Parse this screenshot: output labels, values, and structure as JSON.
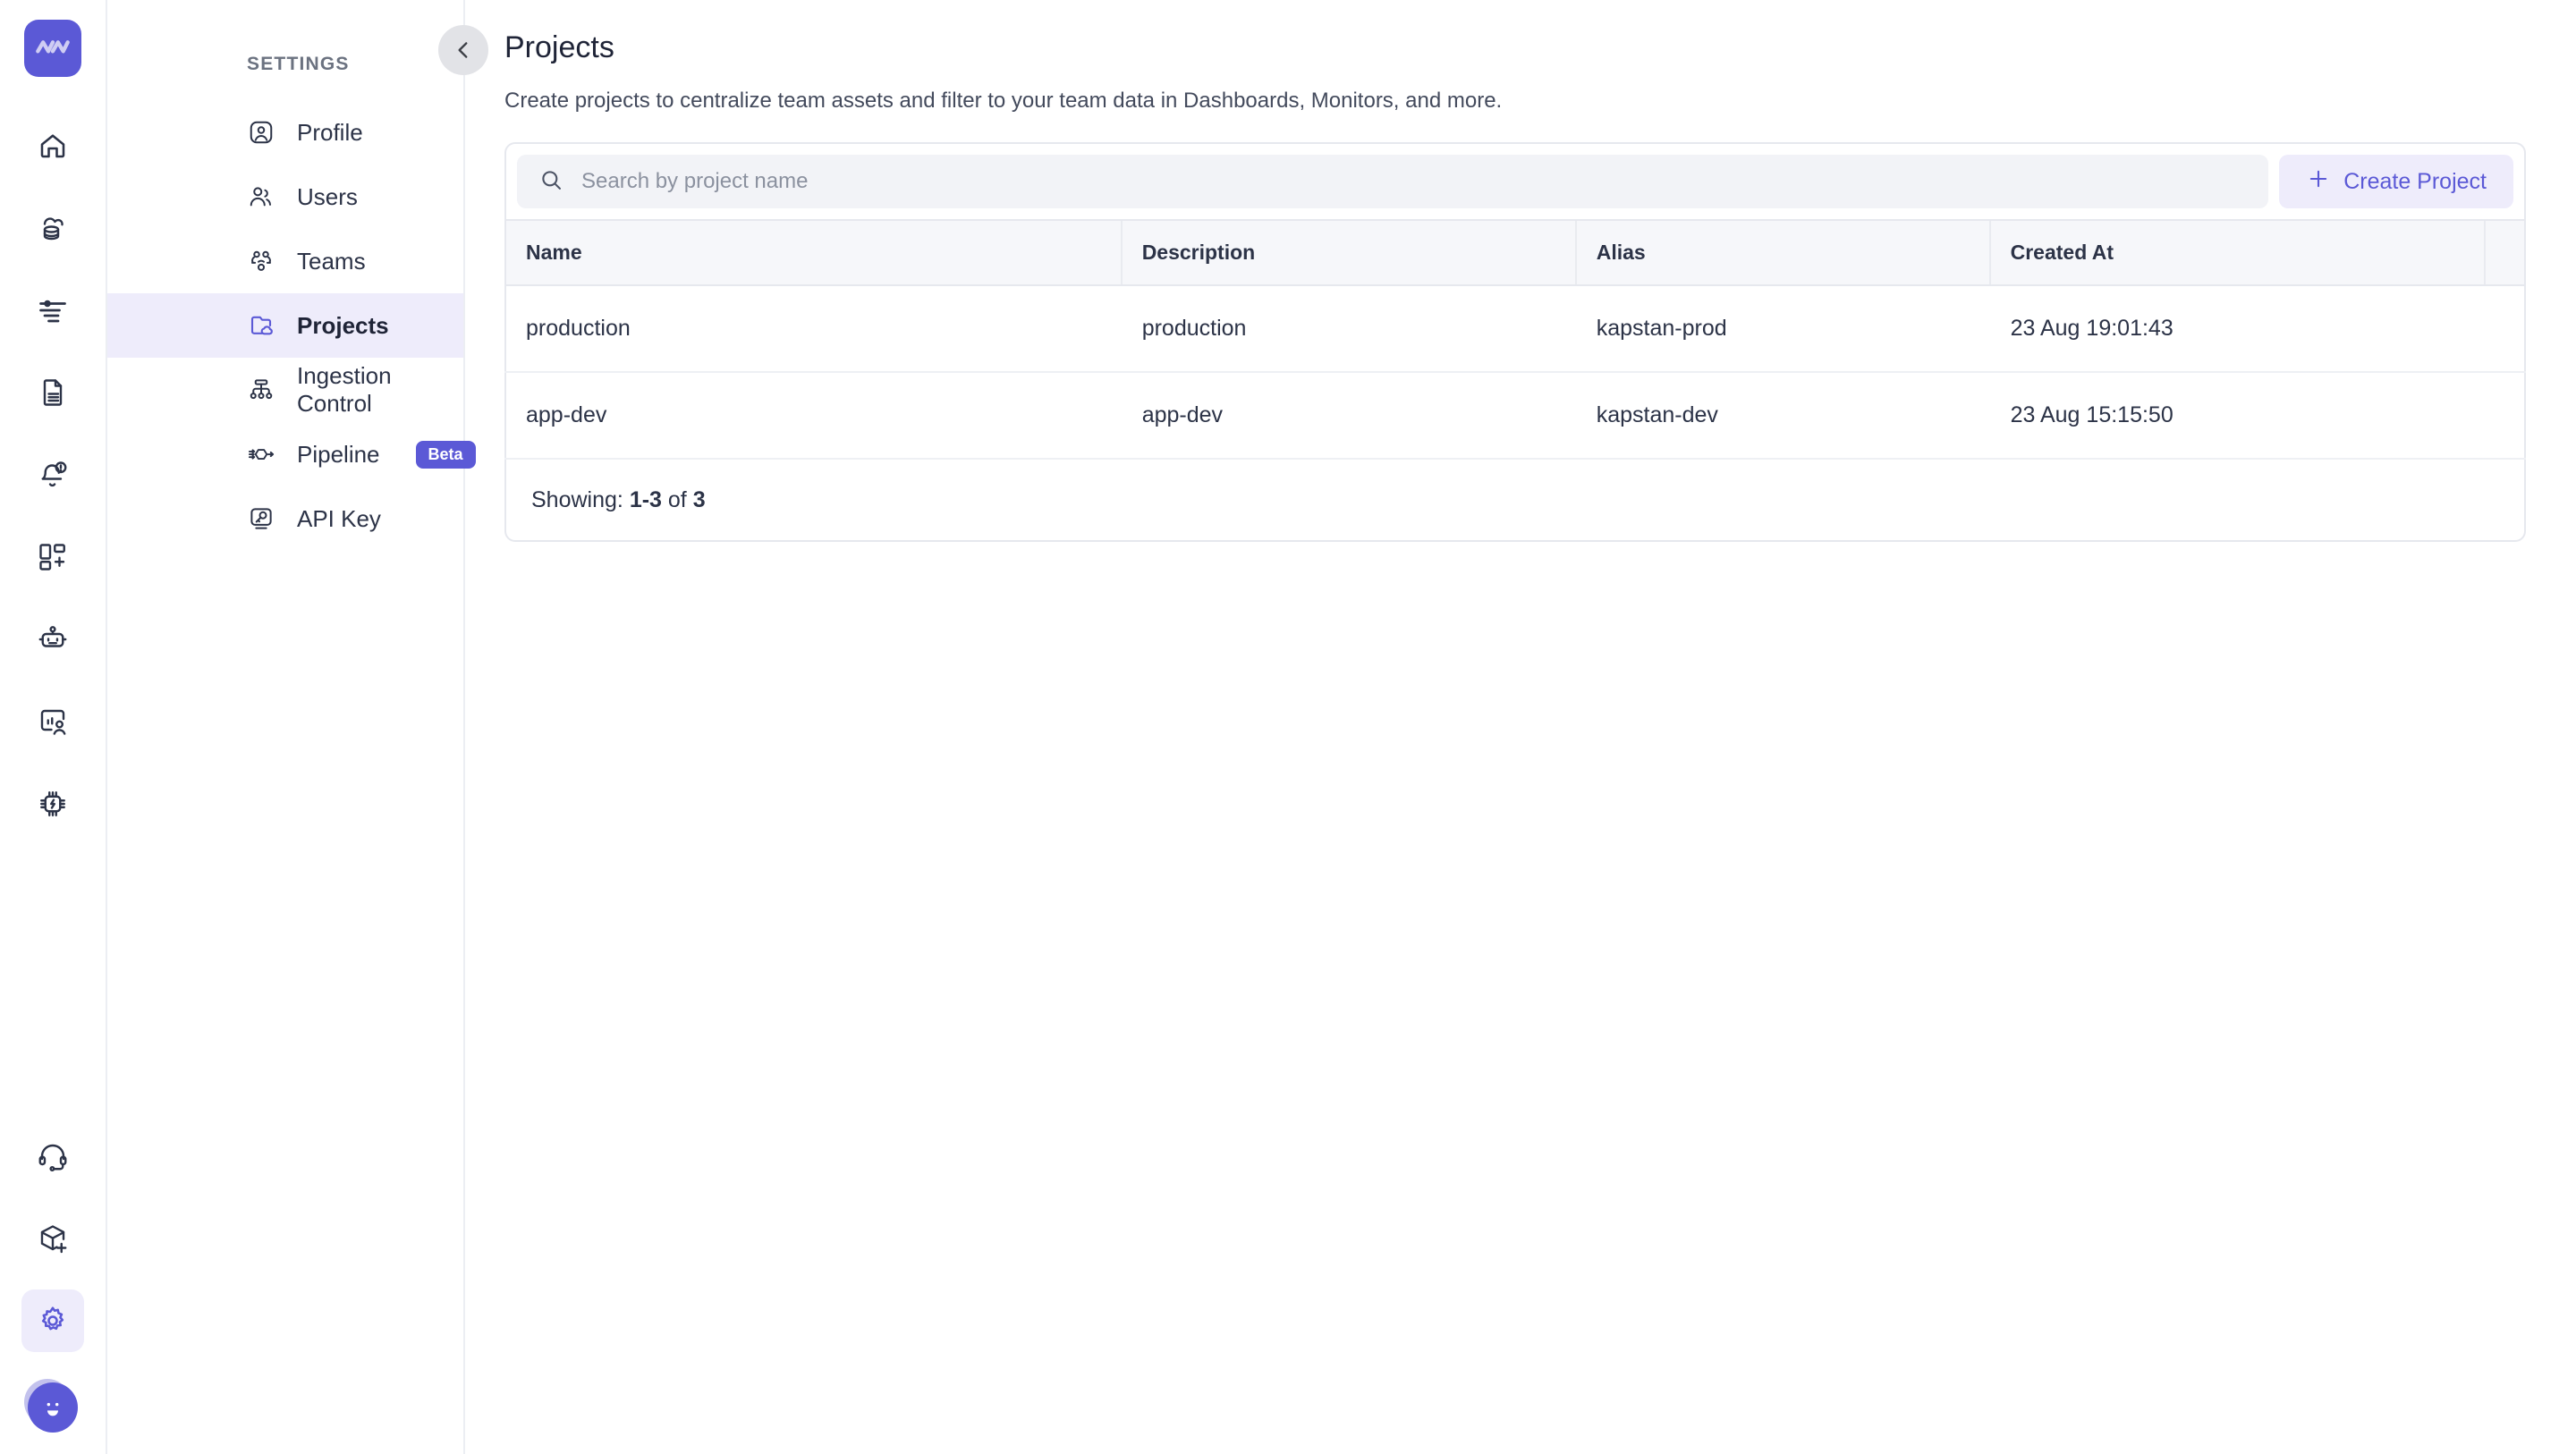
{
  "rail": {
    "logo_name": "monitoring-logo",
    "icons": [
      {
        "name": "home-icon"
      },
      {
        "name": "cloud-database-icon"
      },
      {
        "name": "logs-filter-icon"
      },
      {
        "name": "document-text-icon"
      },
      {
        "name": "alert-bell-icon"
      },
      {
        "name": "dashboard-add-icon"
      },
      {
        "name": "robot-icon"
      },
      {
        "name": "rum-user-icon"
      },
      {
        "name": "cpu-chip-icon"
      }
    ],
    "bottom_icons": [
      {
        "name": "support-headset-icon",
        "active": false
      },
      {
        "name": "add-integration-icon",
        "active": false
      },
      {
        "name": "settings-gear-icon",
        "active": true
      }
    ],
    "avatar_name": "user-avatar"
  },
  "sidebar": {
    "heading": "SETTINGS",
    "collapse_label": "‹",
    "items": [
      {
        "label": "Profile",
        "icon": "profile-circle-icon",
        "active": false,
        "badge": null
      },
      {
        "label": "Users",
        "icon": "users-icon",
        "active": false,
        "badge": null
      },
      {
        "label": "Teams",
        "icon": "teams-icon",
        "active": false,
        "badge": null
      },
      {
        "label": "Projects",
        "icon": "projects-folder-cloud-icon",
        "active": true,
        "badge": null
      },
      {
        "label": "Ingestion Control",
        "icon": "ingestion-hierarchy-icon",
        "active": false,
        "badge": null
      },
      {
        "label": "Pipeline",
        "icon": "pipeline-node-icon",
        "active": false,
        "badge": "Beta"
      },
      {
        "label": "API Key",
        "icon": "api-key-icon",
        "active": false,
        "badge": null
      }
    ]
  },
  "main": {
    "title": "Projects",
    "subtitle": "Create projects to centralize team assets and filter to your team data in Dashboards, Monitors, and more.",
    "search": {
      "placeholder": "Search by project name",
      "value": "",
      "icon": "search-icon"
    },
    "create_button": {
      "label": "Create Project",
      "icon": "plus-icon"
    },
    "table": {
      "columns": [
        "Name",
        "Description",
        "Alias",
        "Created At",
        ""
      ],
      "rows": [
        {
          "name": "production",
          "description": "production",
          "alias": "kapstan-prod",
          "created_at": "23 Aug 19:01:43",
          "actions": ""
        },
        {
          "name": "app-dev",
          "description": "app-dev",
          "alias": "kapstan-dev",
          "created_at": "23 Aug 15:15:50",
          "actions": ""
        }
      ]
    },
    "footer": {
      "showing_label": "Showing:",
      "range": "1-3",
      "of_label": "of",
      "total": "3"
    }
  },
  "colors": {
    "accent": "#5b59d6",
    "accent_bg": "#eeecfb",
    "text": "#2c3347",
    "muted": "#8b919f",
    "border": "#e6e8ee",
    "header_bg": "#f6f7fa",
    "search_bg": "#f2f3f7"
  }
}
